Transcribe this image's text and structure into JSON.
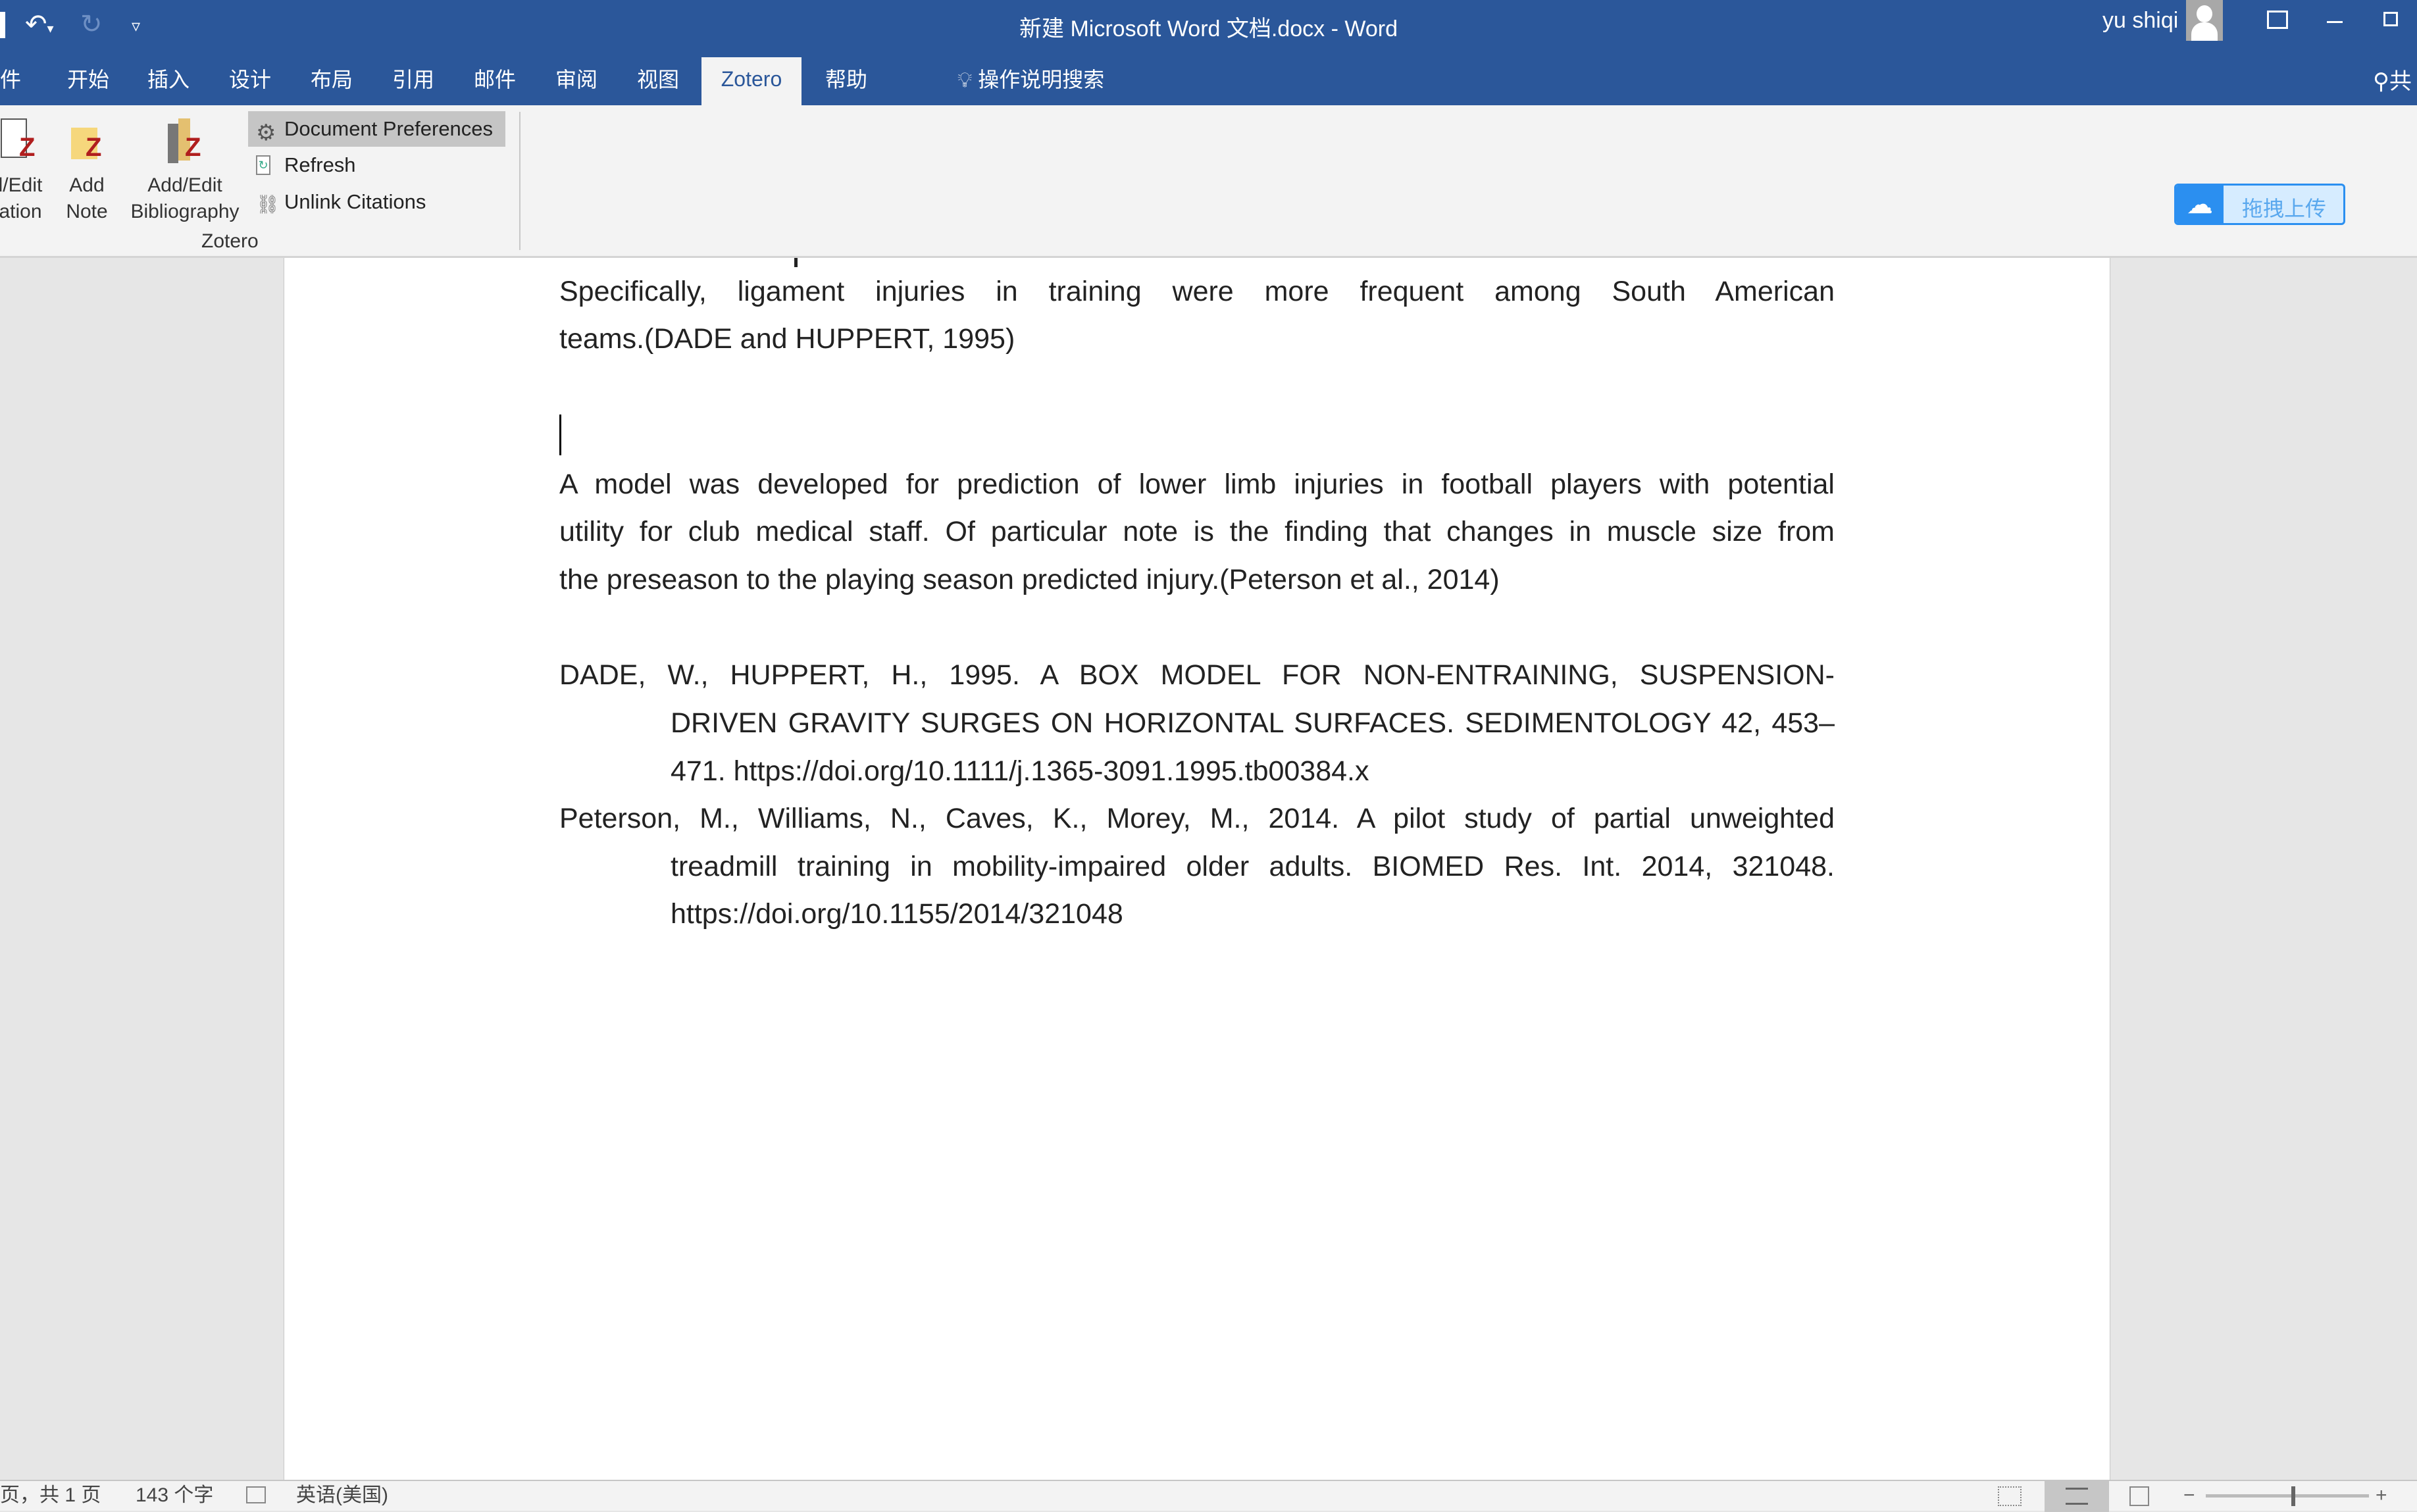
{
  "window": {
    "title": "新建 Microsoft Word 文档.docx  -  Word",
    "user": "yu shiqi"
  },
  "tabs": [
    {
      "label": "件"
    },
    {
      "label": "开始"
    },
    {
      "label": "插入"
    },
    {
      "label": "设计"
    },
    {
      "label": "布局"
    },
    {
      "label": "引用"
    },
    {
      "label": "邮件"
    },
    {
      "label": "审阅"
    },
    {
      "label": "视图"
    },
    {
      "label": "Zotero",
      "active": true
    },
    {
      "label": "帮助"
    }
  ],
  "tell_me": "操作说明搜索",
  "share_label": "共",
  "ribbon": {
    "group_label": "Zotero",
    "add_edit_citation": [
      "l/Edit",
      "ation"
    ],
    "add_note": [
      "Add",
      "Note"
    ],
    "add_edit_bibliography": [
      "Add/Edit",
      "Bibliography"
    ],
    "document_preferences": "Document Preferences",
    "refresh": "Refresh",
    "unlink_citations": "Unlink Citations"
  },
  "upload_widget": {
    "label": "拖拽上传",
    "color": "#2b8ff0"
  },
  "document": {
    "paragraph1": [
      "Specifically, ligament injuries in training were more frequent among South American",
      "teams.(DADE and HUPPERT, 1995)"
    ],
    "paragraph2": [
      "A model was developed for prediction of lower limb injuries in football players with potential",
      "utility for club medical staff. Of particular note is the finding that changes in muscle size from",
      "the preseason to the playing season predicted injury.(Peterson et al., 2014)"
    ],
    "bibliography": [
      [
        "DADE, W., HUPPERT, H., 1995. A BOX MODEL FOR NON-ENTRAINING, SUSPENSION-",
        "DRIVEN GRAVITY SURGES ON HORIZONTAL SURFACES. SEDIMENTOLOGY 42, 453–",
        "471. https://doi.org/10.1111/j.1365-3091.1995.tb00384.x"
      ],
      [
        "Peterson, M., Williams, N., Caves, K., Morey, M., 2014. A pilot study of partial unweighted",
        "treadmill training in mobility-impaired older adults. BIOMED Res. Int. 2014, 321048.",
        "https://doi.org/10.1155/2014/321048"
      ]
    ]
  },
  "status": {
    "page": "页，共 1 页",
    "words": "143 个字",
    "language": "英语(美国)"
  }
}
